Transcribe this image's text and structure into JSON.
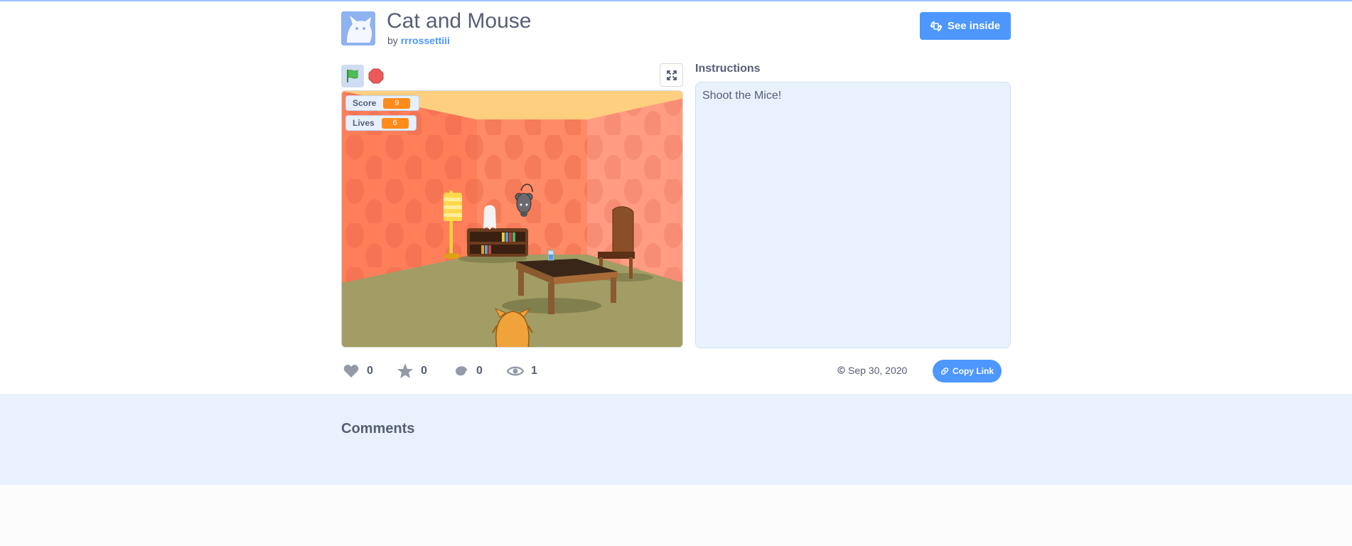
{
  "project": {
    "title": "Cat and Mouse",
    "by_prefix": "by",
    "author": "rrrossettiii",
    "see_inside_label": "See inside"
  },
  "stage": {
    "monitors": [
      {
        "label": "Score",
        "value": "9"
      },
      {
        "label": "Lives",
        "value": "6"
      }
    ]
  },
  "instructions": {
    "heading": "Instructions",
    "text": "Shoot the Mice!"
  },
  "stats": {
    "loves": "0",
    "favorites": "0",
    "remixes": "0",
    "views": "1"
  },
  "shared_date": "Sep 30, 2020",
  "copy_link_label": "Copy Link",
  "comments": {
    "heading": "Comments"
  },
  "colors": {
    "brand_blue": "#4d97ff",
    "text": "#575e75",
    "monitor_value": "#ff8c1a"
  }
}
